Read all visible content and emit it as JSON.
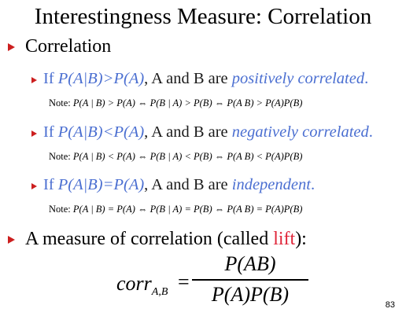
{
  "title": "Interestingness Measure: Correlation",
  "bullet1": "Correlation",
  "sub1": {
    "if": "If ",
    "cond": "P(A|B)>P(A)",
    "mid": ", A and B are ",
    "emph": "positively correlated",
    "end": ".",
    "note_label": "Note: ",
    "note": "P(A | B) > P(A) ⇔ P(B | A) > P(B) ⇔  P(A B) > P(A)P(B)"
  },
  "sub2": {
    "if": "If ",
    "cond": "P(A|B)<P(A)",
    "mid": ", A and B are ",
    "emph": "negatively correlated",
    "end": ".",
    "note_label": "Note: ",
    "note": "P(A | B) < P(A) ⇔ P(B | A) < P(B) ⇔  P(A B) < P(A)P(B)"
  },
  "sub3": {
    "if": "If ",
    "cond": "P(A|B)=P(A)",
    "mid": ", A and B are ",
    "emph": "independent",
    "end": ".",
    "note_label": "Note: ",
    "note": "P(A | B) = P(A) ⇔ P(B | A) = P(B) ⇔  P(A B) = P(A)P(B)"
  },
  "bullet2": {
    "pre": "A measure of correlation (called ",
    "lift": "lift",
    "post": "):"
  },
  "formula": {
    "corr": "corr",
    "sub": "A,B",
    "eq": "=",
    "numerator": "P(AB)",
    "denominator": "P(A)P(B)"
  },
  "page_number": "83",
  "colors": {
    "bullet": "#cc1f1f",
    "blue_text": "#4b6fd1",
    "lift": "#e0263a"
  }
}
